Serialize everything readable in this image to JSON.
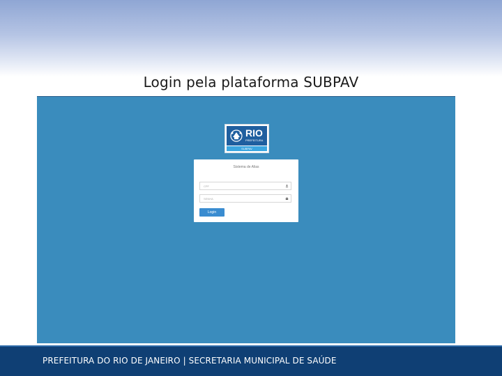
{
  "slide": {
    "title": "Login pela plataforma SUBPAV"
  },
  "logo": {
    "word": "RIO",
    "subtext": "PREFEITURA",
    "strip": "SUBPAV",
    "brand_color": "#1f5f9f",
    "strip_color": "#3ba6e0"
  },
  "login_form": {
    "title": "Sistema de Alias",
    "cpf_placeholder": "CPF",
    "cpf_icon": "user-icon",
    "senha_placeholder": "SENHA",
    "senha_icon": "lock-icon",
    "login_button": "Login",
    "button_color": "#3a8cd0"
  },
  "screenshot_bg": "#3a8cbd",
  "footer": {
    "text": "PREFEITURA DO RIO DE JANEIRO | SECRETARIA MUNICIPAL DE SAÚDE",
    "bg_color": "#0f3f74"
  }
}
